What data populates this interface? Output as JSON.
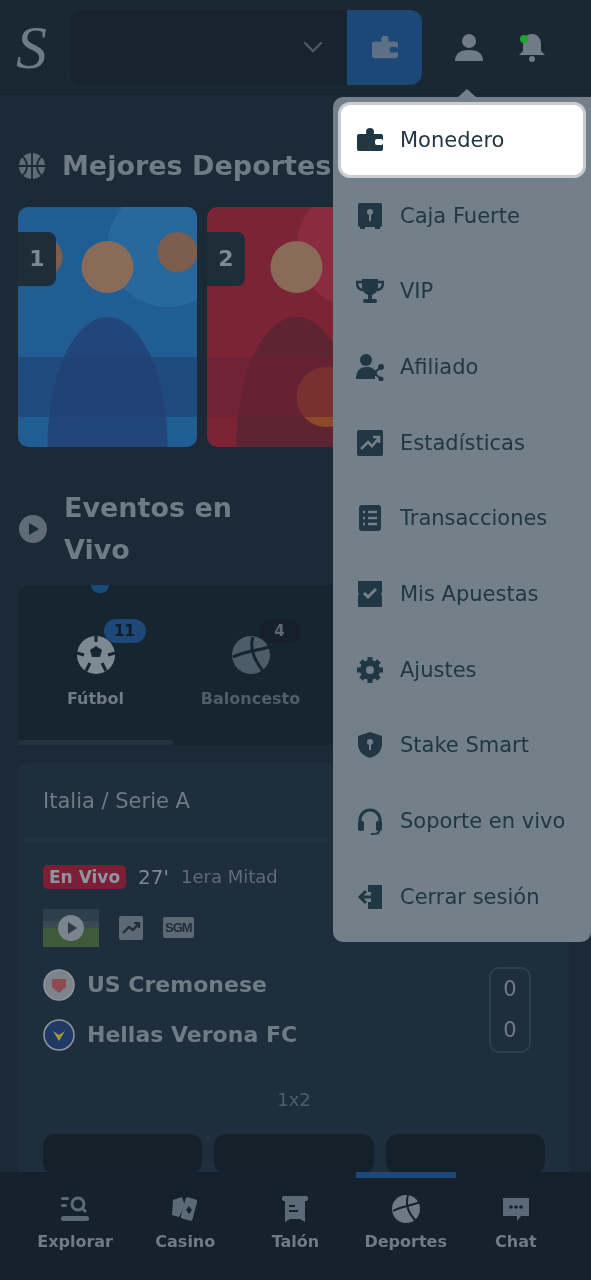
{
  "header": {
    "logo": "S"
  },
  "top_sports": {
    "title": "Mejores Deportes",
    "cards": [
      {
        "rank": "1",
        "kind": "picture"
      },
      {
        "rank": "2",
        "kind": "picture"
      }
    ]
  },
  "live_events": {
    "title": "Eventos en Vivo",
    "tabs": [
      {
        "label": "Fútbol",
        "count": "11",
        "selected": true
      },
      {
        "label": "Baloncesto",
        "count": "4",
        "selected": false
      }
    ]
  },
  "event": {
    "league": "Italia / Serie A",
    "status": "En Vivo",
    "minute": "27'",
    "period": "1era Mitad",
    "sgm": "SGM",
    "teams": [
      {
        "name": "US Cremonese",
        "score": "0"
      },
      {
        "name": "Hellas Verona FC",
        "score": "0"
      }
    ],
    "market": "1x2"
  },
  "account_menu": {
    "items": [
      {
        "label": "Monedero",
        "selected": true
      },
      {
        "label": "Caja Fuerte",
        "selected": false
      },
      {
        "label": "VIP",
        "selected": false
      },
      {
        "label": "Afiliado",
        "selected": false
      },
      {
        "label": "Estadísticas",
        "selected": false
      },
      {
        "label": "Transacciones",
        "selected": false
      },
      {
        "label": "Mis Apuestas",
        "selected": false
      },
      {
        "label": "Ajustes",
        "selected": false
      },
      {
        "label": "Stake Smart",
        "selected": false
      },
      {
        "label": "Soporte en vivo",
        "selected": false
      },
      {
        "label": "Cerrar sesión",
        "selected": false
      }
    ]
  },
  "bottom_nav": [
    {
      "label": "Explorar",
      "selected": false
    },
    {
      "label": "Casino",
      "selected": false
    },
    {
      "label": "Talón",
      "selected": false
    },
    {
      "label": "Deportes",
      "selected": true
    },
    {
      "label": "Chat",
      "selected": false
    }
  ]
}
